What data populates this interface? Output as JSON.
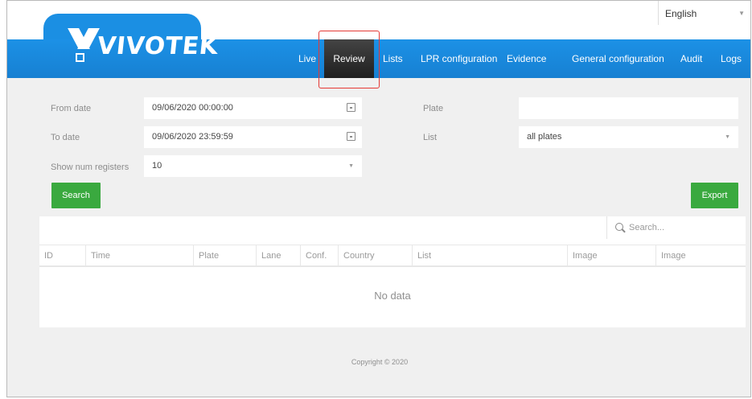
{
  "header": {
    "logo_text": "VIVOTEK",
    "language": "English"
  },
  "nav": {
    "items": [
      {
        "label": "Live"
      },
      {
        "label": "Review",
        "active": true
      },
      {
        "label": "Lists"
      },
      {
        "label": "LPR configuration"
      },
      {
        "label": "Evidence"
      },
      {
        "label": "General configuration"
      },
      {
        "label": "Audit"
      },
      {
        "label": "Logs"
      }
    ]
  },
  "filters": {
    "from_date_label": "From date",
    "from_date_value": "09/06/2020 00:00:00",
    "to_date_label": "To date",
    "to_date_value": "09/06/2020 23:59:59",
    "show_num_label": "Show num registers",
    "show_num_value": "10",
    "plate_label": "Plate",
    "plate_value": "",
    "list_label": "List",
    "list_value": "all plates"
  },
  "buttons": {
    "search": "Search",
    "export": "Export"
  },
  "table": {
    "search_placeholder": "Search...",
    "columns": [
      "ID",
      "Time",
      "Plate",
      "Lane",
      "Conf.",
      "Country",
      "List",
      "Image",
      "Image"
    ],
    "empty_text": "No data"
  },
  "footer": {
    "copyright": "Copyright © 2020"
  },
  "colors": {
    "nav_blue": "#1b8fe3",
    "active_tab": "#2a2a2a",
    "highlight_red": "#e53935",
    "button_green": "#3aa93f"
  }
}
